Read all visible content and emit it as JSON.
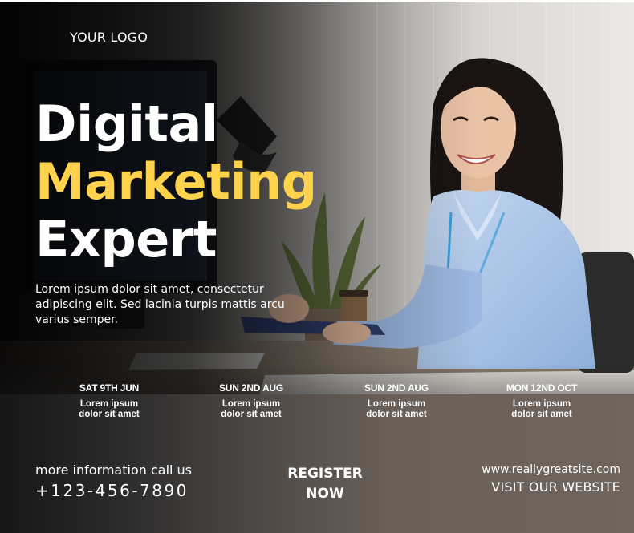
{
  "logo": {
    "text": "YOUR LOGO"
  },
  "headline": {
    "line1": "Digital",
    "line2": "Marketing",
    "line3": "Expert"
  },
  "description": "Lorem ipsum dolor sit amet, consectetur adipiscing elit. Sed lacinia turpis mattis arcu varius semper.",
  "events": [
    {
      "date": "SAT 9TH JUN",
      "text": "Lorem ipsum dolor sit amet"
    },
    {
      "date": "SUN 2ND AUG",
      "text": "Lorem ipsum dolor sit amet"
    },
    {
      "date": "SUN 2ND AUG",
      "text": "Lorem ipsum dolor sit amet"
    },
    {
      "date": "MON 12ND OCT",
      "text": "Lorem ipsum dolor sit amet"
    }
  ],
  "contact": {
    "label": "more information call us",
    "phone": "+123-456-7890"
  },
  "register": {
    "line1": "REGISTER",
    "line2": "NOW"
  },
  "website": {
    "url": "www.reallygreatsite.com",
    "visit": "VISIT OUR WEBSITE"
  },
  "colors": {
    "accent_yellow": "#ffd24c",
    "text_white": "#ffffff",
    "shirt_blue": "#aac6ea"
  }
}
